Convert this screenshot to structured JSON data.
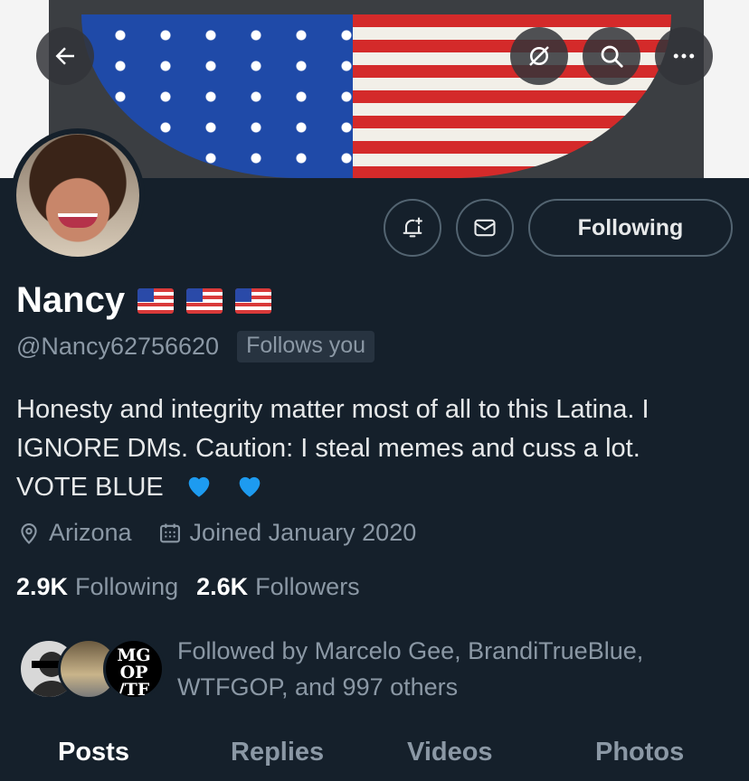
{
  "header": {
    "back_icon": "arrow-left-icon",
    "action_icons": [
      "grok-icon",
      "search-icon",
      "more-icon"
    ]
  },
  "profile": {
    "name": "Nancy",
    "name_emojis": [
      "flag-us",
      "flag-us",
      "flag-us"
    ],
    "handle": "@Nancy62756620",
    "follows_you": "Follows you",
    "bio_lines": [
      "Honesty and integrity matter most of all to this Latina. I",
      "IGNORE DMs. Caution: I steal memes and cuss a lot.",
      "VOTE BLUE"
    ],
    "location": "Arizona",
    "joined": "Joined January 2020",
    "following_count": "2.9K",
    "following_label": "Following",
    "followers_count": "2.6K",
    "followers_label": "Followers",
    "followed_by": "Followed by Marcelo Gee, BrandiTrueBlue, WTFGOP, and 997 others",
    "followed_by_avatar3_text": [
      "MG",
      "OP",
      "/TF"
    ]
  },
  "actions": {
    "notify_icon": "bell-plus-icon",
    "message_icon": "envelope-icon",
    "following_label": "Following"
  },
  "tabs": [
    {
      "label": "Posts",
      "active": true
    },
    {
      "label": "Replies",
      "active": false
    },
    {
      "label": "Videos",
      "active": false
    },
    {
      "label": "Photos",
      "active": false
    }
  ],
  "colors": {
    "background": "#15202b",
    "secondary_text": "#8b98a5",
    "heart": "#1d9bf0"
  }
}
